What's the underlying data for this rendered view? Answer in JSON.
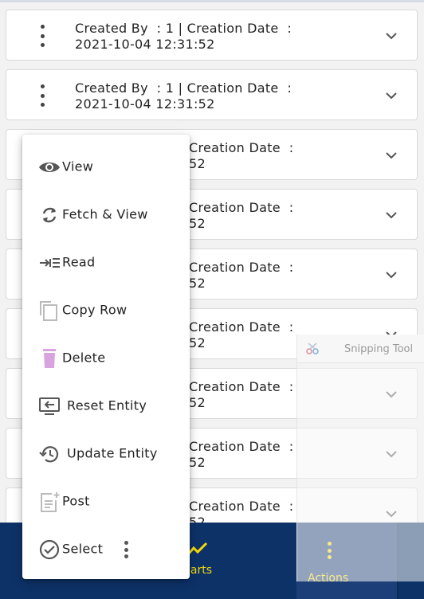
{
  "cards": [
    {
      "line1": "Created By  : 1 | Creation Date  :",
      "line2": "2021-10-04 12:31:52"
    },
    {
      "line1": "Created By  : 1 | Creation Date  :",
      "line2": "2021-10-04 12:31:52"
    },
    {
      "line1": "Creation Date  :",
      "line2": "52"
    },
    {
      "line1": "Creation Date  :",
      "line2": "52"
    },
    {
      "line1": "Creation Date  :",
      "line2": "52"
    },
    {
      "line1": "Creation Date  :",
      "line2": "52"
    },
    {
      "line1": "Creation Date  :",
      "line2": "52"
    },
    {
      "line1": "Creation Date  :",
      "line2": "52"
    },
    {
      "line1": "Creation Date  :",
      "line2": "52"
    }
  ],
  "menu": {
    "items": [
      {
        "label": "View",
        "icon": "eye-icon"
      },
      {
        "label": "Fetch & View",
        "icon": "refresh-icon"
      },
      {
        "label": "Read",
        "icon": "read-arrow-icon"
      },
      {
        "label": "Copy Row",
        "icon": "copy-icon"
      },
      {
        "label": "Delete",
        "icon": "trash-icon"
      },
      {
        "label": "Reset Entity",
        "icon": "reset-screen-icon"
      },
      {
        "label": "Update Entity",
        "icon": "history-icon"
      },
      {
        "label": "Post",
        "icon": "post-add-icon"
      },
      {
        "label": "Select",
        "icon": "check-circle-icon"
      }
    ]
  },
  "bottom_nav": {
    "charts_label": "harts",
    "actions_label": "Actions"
  },
  "snipping_tool": {
    "title": "Snipping Tool"
  },
  "colors": {
    "nav_bg": "#0d3268",
    "nav_active": "#1c3f7a",
    "accent": "#f5d90a",
    "delete_icon": "#d9a3df"
  }
}
